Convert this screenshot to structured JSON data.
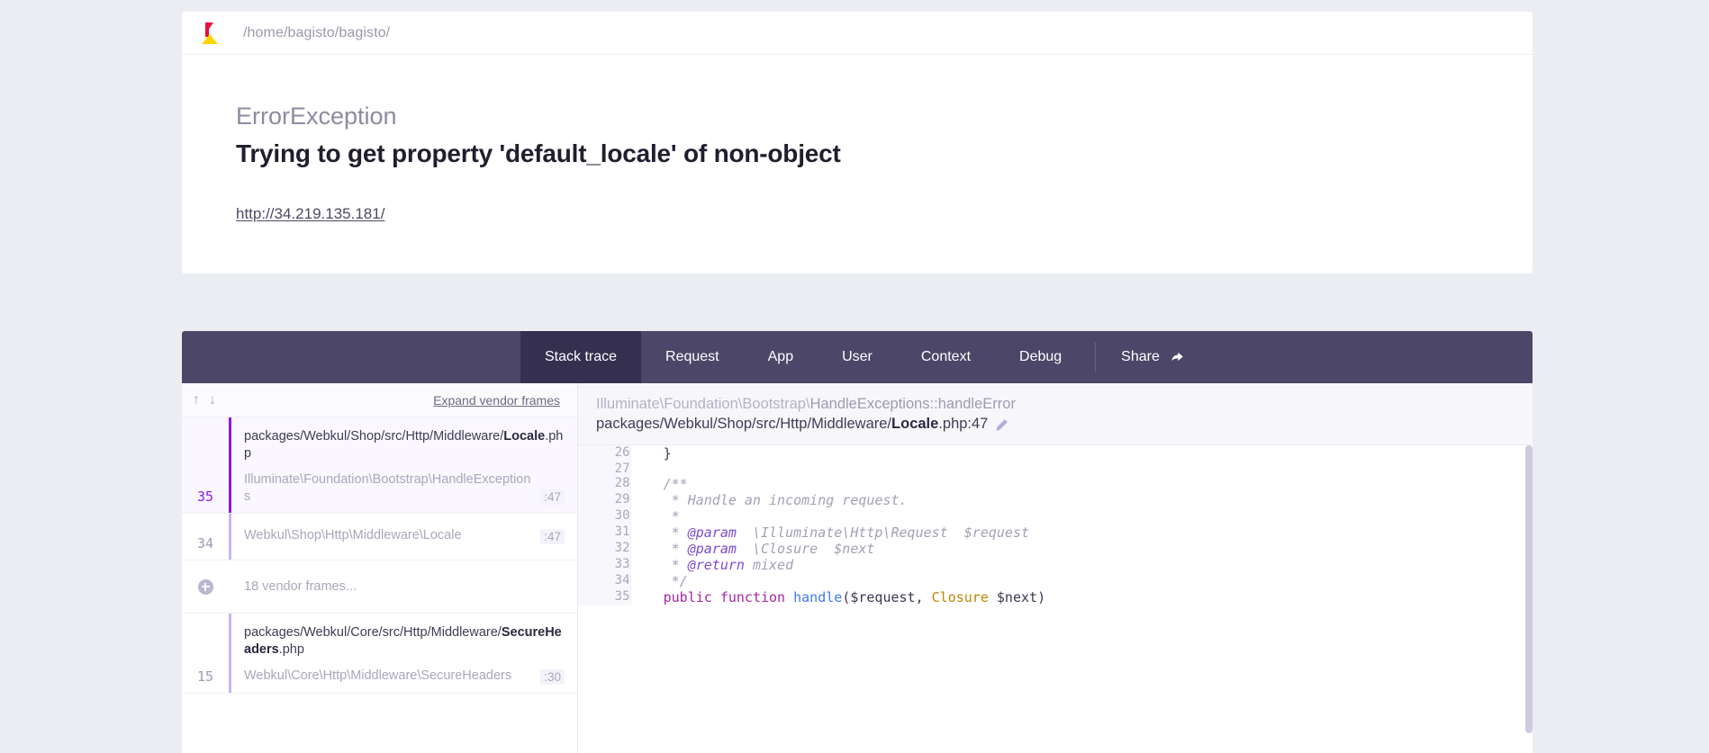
{
  "app": {
    "logo_icon": "flare-logo-icon",
    "project_path": "/home/bagisto/bagisto/"
  },
  "exception": {
    "class": "ErrorException",
    "message": "Trying to get property 'default_locale' of non-object",
    "url": "http://34.219.135.181/"
  },
  "tabs": [
    {
      "label": "Stack trace",
      "active": true
    },
    {
      "label": "Request",
      "active": false
    },
    {
      "label": "App",
      "active": false
    },
    {
      "label": "User",
      "active": false
    },
    {
      "label": "Context",
      "active": false
    },
    {
      "label": "Debug",
      "active": false
    }
  ],
  "share": {
    "label": "Share",
    "icon": "share-arrow-icon"
  },
  "frames_header": {
    "up_arrow_icon": "arrow-up-icon",
    "down_arrow_icon": "arrow-down-icon",
    "expand_vendor_label": "Expand vendor frames"
  },
  "frames": [
    {
      "number": "35",
      "file_path": "packages/Webkul/Shop/src/Http/Middleware/",
      "file_name": "Locale",
      "file_ext": ".php",
      "class_name": "Illuminate\\Foundation\\Bootstrap\\HandleExceptions",
      "line": ":47",
      "selected": true,
      "type": "frame"
    },
    {
      "number": "34",
      "file_path": "",
      "file_name": "",
      "file_ext": "",
      "class_name": "Webkul\\Shop\\Http\\Middleware\\Locale",
      "line": ":47",
      "selected": false,
      "type": "frame-compact"
    },
    {
      "number": "",
      "vendor_label": "18 vendor frames...",
      "expand_icon": "plus-circle-icon",
      "type": "vendor"
    },
    {
      "number": "15",
      "file_path": "packages/Webkul/Core/src/Http/Middleware/",
      "file_name": "SecureHeaders",
      "file_ext": ".php",
      "class_name": "Webkul\\Core\\Http\\Middleware\\SecureHeaders",
      "line": ":30",
      "selected": false,
      "type": "frame"
    }
  ],
  "code_header": {
    "class_namespace": "Illuminate\\Foundation\\Bootstrap\\",
    "class_method": "HandleExceptions::handleError",
    "file_prefix": "packages/Webkul/Shop/src/Http/Middleware/",
    "file_bold": "Locale",
    "file_suffix": ".php:47",
    "edit_icon": "pencil-edit-icon"
  },
  "code_lines": [
    {
      "num": "26",
      "tokens": [
        {
          "t": "    }",
          "c": "c-punc"
        }
      ]
    },
    {
      "num": "27",
      "tokens": [
        {
          "t": "",
          "c": "c-punc"
        }
      ]
    },
    {
      "num": "28",
      "tokens": [
        {
          "t": "    /**",
          "c": "c-comment"
        }
      ]
    },
    {
      "num": "29",
      "tokens": [
        {
          "t": "     * Handle an incoming request.",
          "c": "c-comment"
        }
      ]
    },
    {
      "num": "30",
      "tokens": [
        {
          "t": "     *",
          "c": "c-comment"
        }
      ]
    },
    {
      "num": "31",
      "tokens": [
        {
          "t": "     * ",
          "c": "c-comment"
        },
        {
          "t": "@param",
          "c": "c-annot"
        },
        {
          "t": "  \\Illuminate\\Http\\Request  $request",
          "c": "c-comment"
        }
      ]
    },
    {
      "num": "32",
      "tokens": [
        {
          "t": "     * ",
          "c": "c-comment"
        },
        {
          "t": "@param",
          "c": "c-annot"
        },
        {
          "t": "  \\Closure  $next",
          "c": "c-comment"
        }
      ]
    },
    {
      "num": "33",
      "tokens": [
        {
          "t": "     * ",
          "c": "c-comment"
        },
        {
          "t": "@return",
          "c": "c-annot"
        },
        {
          "t": " mixed",
          "c": "c-comment"
        }
      ]
    },
    {
      "num": "34",
      "tokens": [
        {
          "t": "     */",
          "c": "c-comment"
        }
      ]
    },
    {
      "num": "35",
      "tokens": [
        {
          "t": "    ",
          "c": "c-punc"
        },
        {
          "t": "public function ",
          "c": "c-kw"
        },
        {
          "t": "handle",
          "c": "c-fn"
        },
        {
          "t": "(",
          "c": "c-punc"
        },
        {
          "t": "$request",
          "c": "c-var"
        },
        {
          "t": ", ",
          "c": "c-punc"
        },
        {
          "t": "Closure",
          "c": "c-cls"
        },
        {
          "t": " $next",
          "c": "c-var"
        },
        {
          "t": ")",
          "c": "c-punc"
        }
      ]
    }
  ],
  "colors": {
    "page_background": "#ecedf3",
    "tabbar": "#4c4668",
    "tab_active": "#352f50",
    "accent_purple": "#8b19e8",
    "logo_red": "#e6123d",
    "logo_yellow": "#ffd500"
  }
}
